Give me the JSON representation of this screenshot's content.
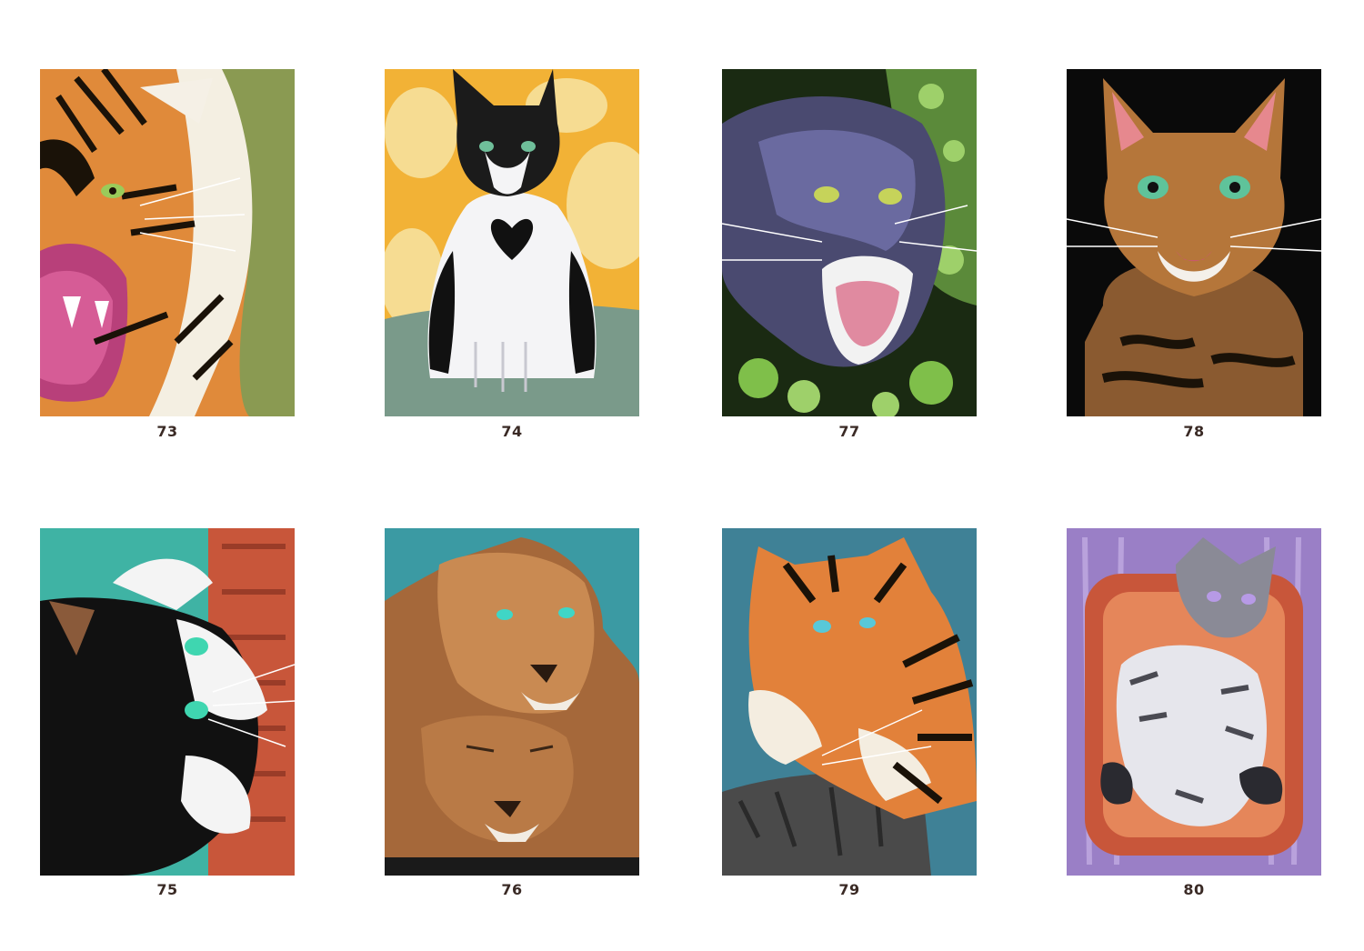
{
  "cards": [
    {
      "number": "73",
      "subject": "roaring-tiger",
      "background": "#8a9a52"
    },
    {
      "number": "74",
      "subject": "black-white-cat",
      "background": "#f2b236"
    },
    {
      "number": "77",
      "subject": "black-panther",
      "background": "#5b8a3a"
    },
    {
      "number": "78",
      "subject": "bengal-cat",
      "background": "#0a0a0a"
    },
    {
      "number": "75",
      "subject": "calico-cat",
      "background": "#3fb3a4"
    },
    {
      "number": "76",
      "subject": "two-lions",
      "background": "#3b9aa3"
    },
    {
      "number": "79",
      "subject": "tiger-on-rock",
      "background": "#3f8196"
    },
    {
      "number": "80",
      "subject": "kitten-in-basket",
      "background": "#9a7fc6"
    }
  ]
}
